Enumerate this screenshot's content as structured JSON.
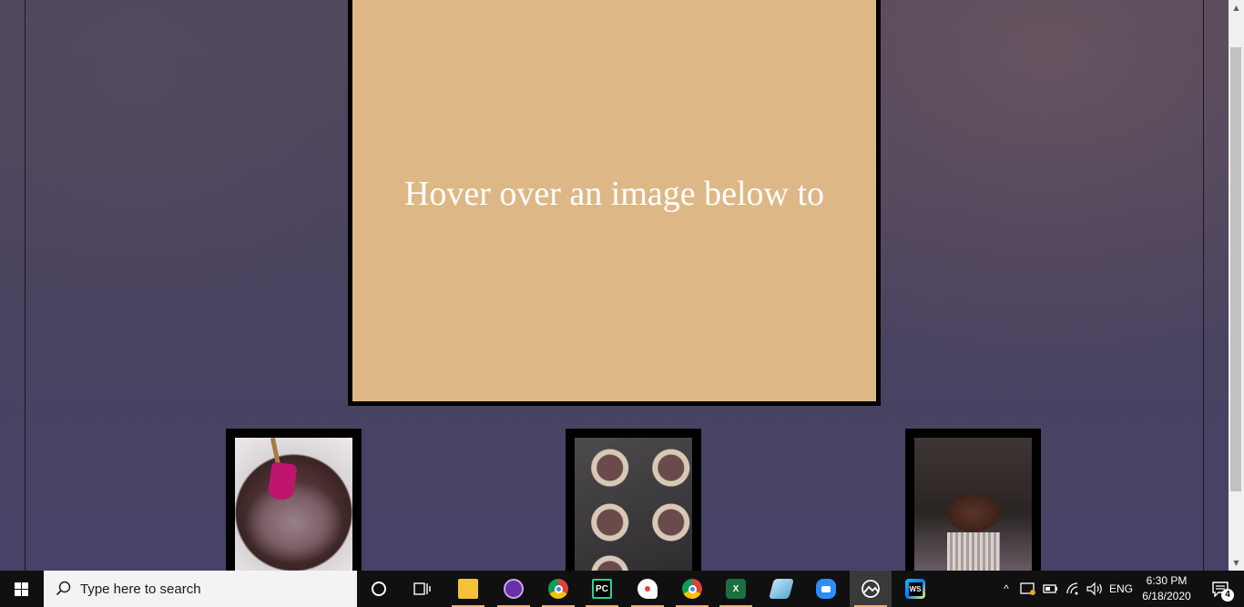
{
  "page": {
    "hover_text": "Hover over an image below to",
    "images": [
      {
        "name": "chocolate batter in bowl with spatula"
      },
      {
        "name": "cupcake liners with batter in tin"
      },
      {
        "name": "chocolate frosted cupcake"
      }
    ]
  },
  "colors": {
    "hover_box_bg": "#ddb886",
    "page_bg": "#474163",
    "taskbar_bg": "#101010"
  },
  "taskbar": {
    "search_placeholder": "Type here to search",
    "apps": [
      {
        "icon": "cortana-icon"
      },
      {
        "icon": "task-view-icon"
      },
      {
        "icon": "file-explorer-icon"
      },
      {
        "icon": "purple-app-icon"
      },
      {
        "icon": "chrome-icon"
      },
      {
        "icon": "pycharm-icon",
        "label": "PC"
      },
      {
        "icon": "paint-icon"
      },
      {
        "icon": "chrome-icon"
      },
      {
        "icon": "excel-icon",
        "label": "X"
      },
      {
        "icon": "notes-icon"
      },
      {
        "icon": "zoom-icon"
      },
      {
        "icon": "photos-icon"
      },
      {
        "icon": "webstorm-icon",
        "label": "WS"
      }
    ],
    "tray": {
      "language": "ENG",
      "time": "6:30 PM",
      "date": "6/18/2020",
      "notifications": "4"
    }
  }
}
